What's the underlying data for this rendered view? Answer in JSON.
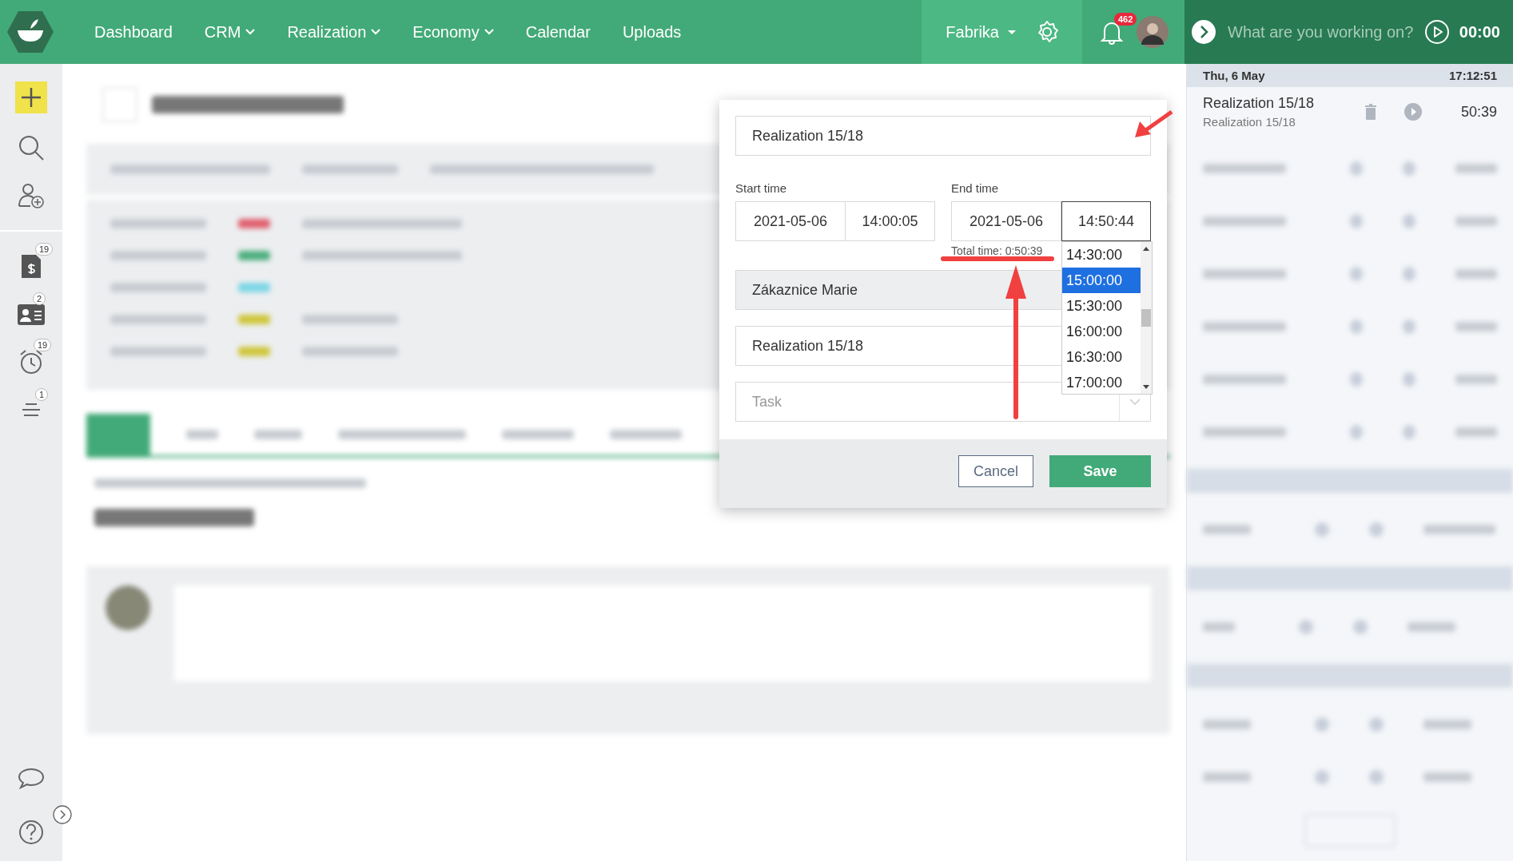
{
  "top_bar": {
    "nav": [
      {
        "label": "Dashboard",
        "dropdown": false
      },
      {
        "label": "CRM",
        "dropdown": true
      },
      {
        "label": "Realization",
        "dropdown": true
      },
      {
        "label": "Economy",
        "dropdown": true
      },
      {
        "label": "Calendar",
        "dropdown": false
      },
      {
        "label": "Uploads",
        "dropdown": false
      }
    ],
    "workspace": "Fabrika",
    "notification_count": "462",
    "timer": {
      "placeholder": "What are you working on?",
      "time": "00:00"
    }
  },
  "sidebar": {
    "top": [
      {
        "kind": "add"
      },
      {
        "kind": "search"
      },
      {
        "kind": "user-add"
      }
    ],
    "middle": [
      {
        "kind": "invoice",
        "badge": "19"
      },
      {
        "kind": "contact",
        "badge": "2"
      },
      {
        "kind": "alarm",
        "badge": "19"
      },
      {
        "kind": "list",
        "badge": "1"
      }
    ],
    "bottom": [
      {
        "kind": "chat"
      },
      {
        "kind": "help"
      }
    ]
  },
  "dialog": {
    "description": "Realization 15/18",
    "start": {
      "label": "Start time",
      "date": "2021-05-06",
      "time": "14:00:05"
    },
    "end": {
      "label": "End time",
      "date": "2021-05-06",
      "time": "14:50:44"
    },
    "total": "Total time: 0:50:39",
    "time_options": [
      {
        "label": "14:30:00",
        "selected": false
      },
      {
        "label": "15:00:00",
        "selected": true
      },
      {
        "label": "15:30:00",
        "selected": false
      },
      {
        "label": "16:00:00",
        "selected": false
      },
      {
        "label": "16:30:00",
        "selected": false
      },
      {
        "label": "17:00:00",
        "selected": false
      }
    ],
    "client": "Zákaznice Marie",
    "project": "Realization 15/18",
    "task": {
      "placeholder": "Task"
    },
    "cancel": "Cancel",
    "save": "Save"
  },
  "time_panel": {
    "date": "Thu, 6 May",
    "total": "17:12:51",
    "entries": [
      {
        "title": "Realization 15/18",
        "subtitle": "Realization 15/18",
        "duration": "50:39"
      }
    ]
  }
}
